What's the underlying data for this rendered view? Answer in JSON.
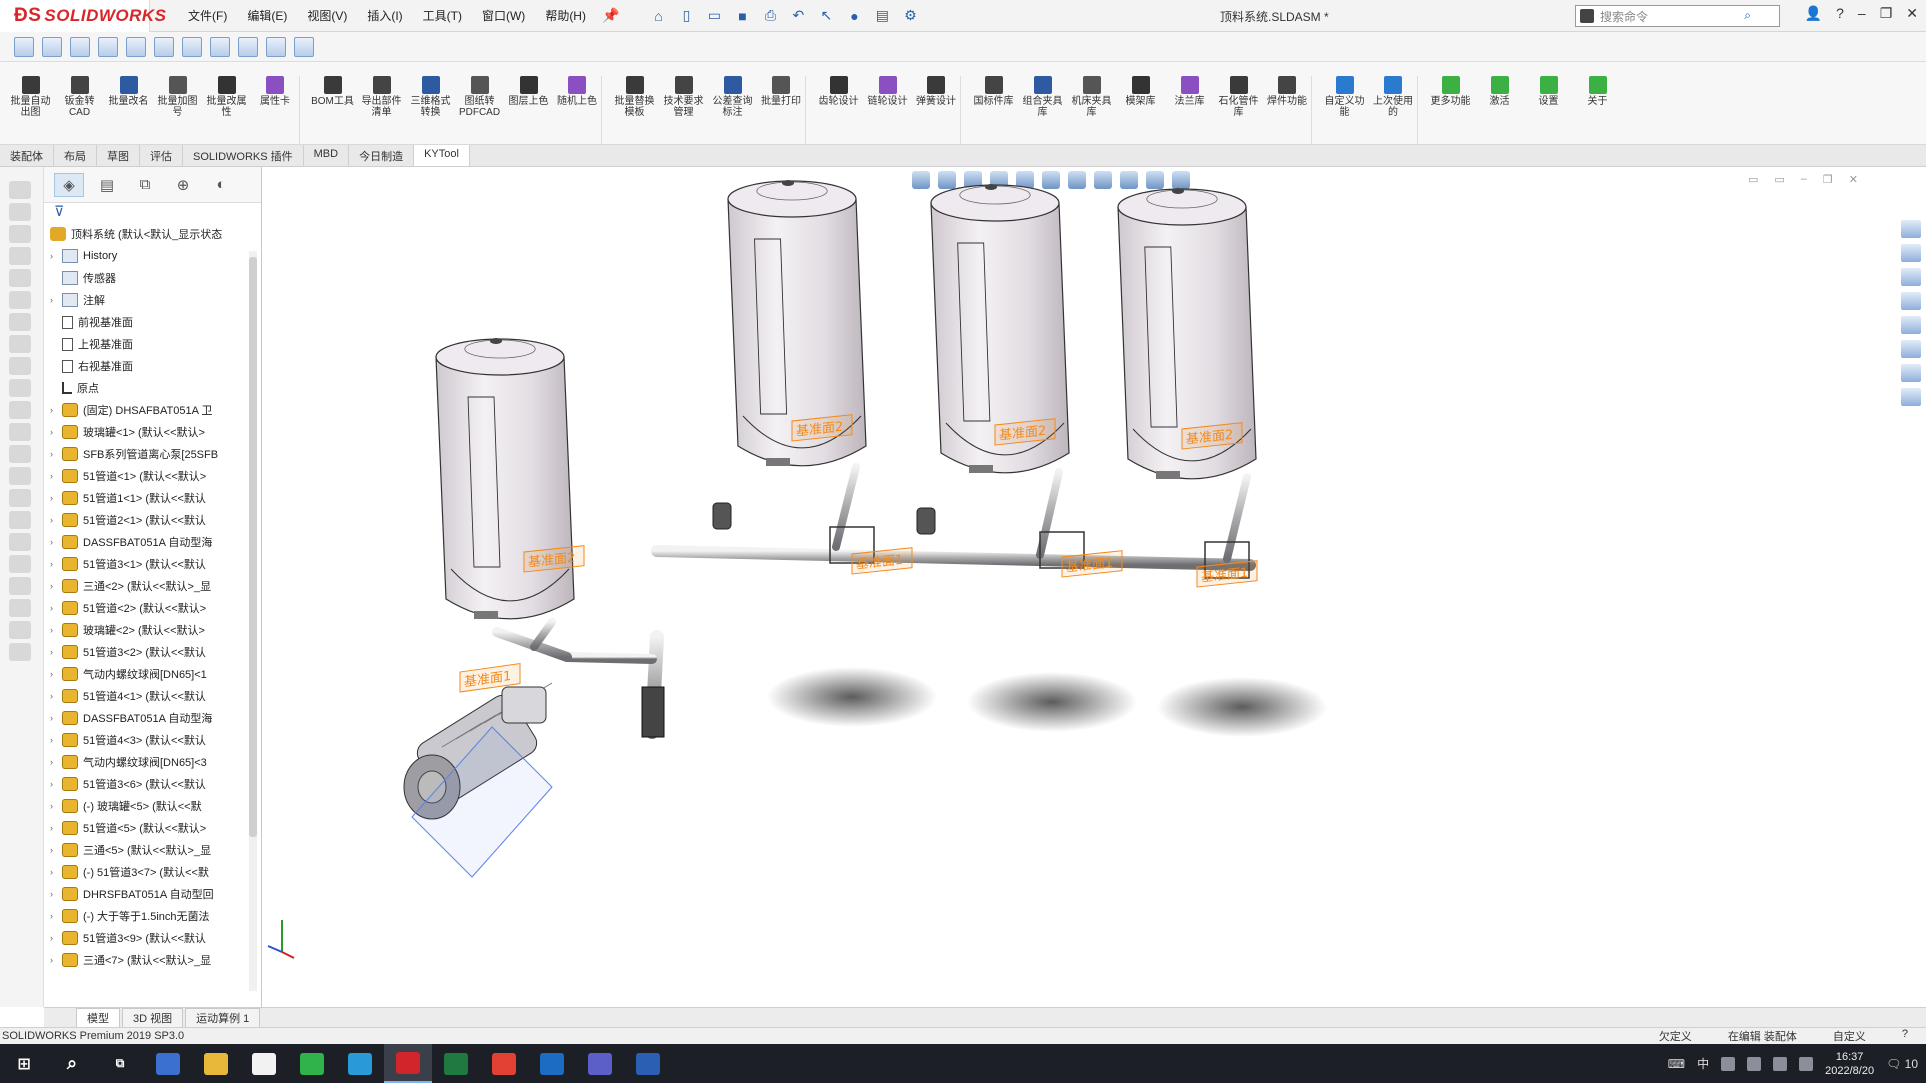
{
  "app": {
    "logo_text": "SOLIDWORKS",
    "document_title": "顶料系统.SLDASM *",
    "menus": [
      "文件(F)",
      "编辑(E)",
      "视图(V)",
      "插入(I)",
      "工具(T)",
      "窗口(W)",
      "帮助(H)"
    ],
    "search_placeholder": "搜索命令"
  },
  "command_manager": [
    "批量自动出图",
    "钣金转CAD",
    "批量改名",
    "批量加图号",
    "批量改属性",
    "属性卡",
    "BOM工具",
    "导出部件清单",
    "三维格式转换",
    "图纸转PDFCAD",
    "图层上色",
    "随机上色",
    "批量替换模板",
    "技术要求管理",
    "公差查询标注",
    "批量打印",
    "齿轮设计",
    "链轮设计",
    "弹簧设计",
    "国标件库",
    "组合夹具库",
    "机床夹具库",
    "模架库",
    "法兰库",
    "石化管件库",
    "焊件功能",
    "自定义功能",
    "上次使用的",
    "更多功能",
    "激活",
    "设置",
    "关于"
  ],
  "tabs": [
    "装配体",
    "布局",
    "草图",
    "评估",
    "SOLIDWORKS 插件",
    "MBD",
    "今日制造",
    "KYTool"
  ],
  "active_tab": "KYTool",
  "feature_tree": {
    "root": "顶料系统 (默认<默认_显示状态",
    "items": [
      {
        "label": "History",
        "icon": "folder",
        "expand": true
      },
      {
        "label": "传感器",
        "icon": "folder",
        "expand": false
      },
      {
        "label": "注解",
        "icon": "folder",
        "expand": true
      },
      {
        "label": "前视基准面",
        "icon": "plane",
        "expand": false
      },
      {
        "label": "上视基准面",
        "icon": "plane",
        "expand": false
      },
      {
        "label": "右视基准面",
        "icon": "plane",
        "expand": false
      },
      {
        "label": "原点",
        "icon": "origin",
        "expand": false
      },
      {
        "label": "(固定) DHSAFBAT051A 卫",
        "icon": "part",
        "expand": true
      },
      {
        "label": "玻璃罐<1> (默认<<默认>",
        "icon": "part",
        "expand": true
      },
      {
        "label": "SFB系列管道离心泵[25SFB",
        "icon": "part",
        "expand": true
      },
      {
        "label": "51管道<1> (默认<<默认>",
        "icon": "part",
        "expand": true
      },
      {
        "label": "51管道1<1> (默认<<默认",
        "icon": "part",
        "expand": true
      },
      {
        "label": "51管道2<1> (默认<<默认",
        "icon": "part",
        "expand": true
      },
      {
        "label": "DASSFBAT051A 自动型海",
        "icon": "part",
        "expand": true
      },
      {
        "label": "51管道3<1> (默认<<默认",
        "icon": "part",
        "expand": true
      },
      {
        "label": "三通<2> (默认<<默认>_显",
        "icon": "part",
        "expand": true
      },
      {
        "label": "51管道<2> (默认<<默认>",
        "icon": "part",
        "expand": true
      },
      {
        "label": "玻璃罐<2> (默认<<默认>",
        "icon": "part",
        "expand": true
      },
      {
        "label": "51管道3<2> (默认<<默认",
        "icon": "part",
        "expand": true
      },
      {
        "label": "气动内螺纹球阀[DN65]<1",
        "icon": "part",
        "expand": true
      },
      {
        "label": "51管道4<1> (默认<<默认",
        "icon": "part",
        "expand": true
      },
      {
        "label": "DASSFBAT051A 自动型海",
        "icon": "part",
        "expand": true
      },
      {
        "label": "51管道4<3> (默认<<默认",
        "icon": "part",
        "expand": true
      },
      {
        "label": "气动内螺纹球阀[DN65]<3",
        "icon": "part",
        "expand": true
      },
      {
        "label": "51管道3<6> (默认<<默认",
        "icon": "part",
        "expand": true
      },
      {
        "label": "(-) 玻璃罐<5> (默认<<默",
        "icon": "part",
        "expand": true
      },
      {
        "label": "51管道<5> (默认<<默认>",
        "icon": "part",
        "expand": true
      },
      {
        "label": "三通<5> (默认<<默认>_显",
        "icon": "part",
        "expand": true
      },
      {
        "label": "(-) 51管道3<7> (默认<<默",
        "icon": "part",
        "expand": true
      },
      {
        "label": "DHRSFBAT051A 自动型回",
        "icon": "part",
        "expand": true
      },
      {
        "label": "(-) 大于等于1.5inch无菌法",
        "icon": "part",
        "expand": true
      },
      {
        "label": "51管道3<9> (默认<<默认",
        "icon": "part",
        "expand": true
      },
      {
        "label": "三通<7> (默认<<默认>_显",
        "icon": "part",
        "expand": true
      }
    ]
  },
  "model": {
    "plane_labels": [
      "基准面2",
      "基准面2",
      "基准面2",
      "基准面2",
      "基准面1",
      "基准面1",
      "基准面1",
      "基准面1"
    ],
    "plane_color": "#f28a1e",
    "tank_color": "#d9d4db"
  },
  "bottom_tabs": [
    "模型",
    "3D 视图",
    "运动算例 1"
  ],
  "active_bottom_tab": "模型",
  "status": {
    "left": "SOLIDWORKS Premium 2019 SP3.0",
    "under_defined": "欠定义",
    "editing": "在编辑 装配体",
    "custom": "自定义"
  },
  "taskbar": {
    "apps": [
      "search",
      "task-view",
      "outlook-grid",
      "explorer",
      "notion",
      "wechat",
      "edge-helper",
      "solidworks",
      "excel",
      "chrome",
      "outlook",
      "teams",
      "word"
    ],
    "active_app": "solidworks",
    "ime": "中",
    "time": "16:37",
    "date": "2022/8/20",
    "notif_count": "10"
  }
}
